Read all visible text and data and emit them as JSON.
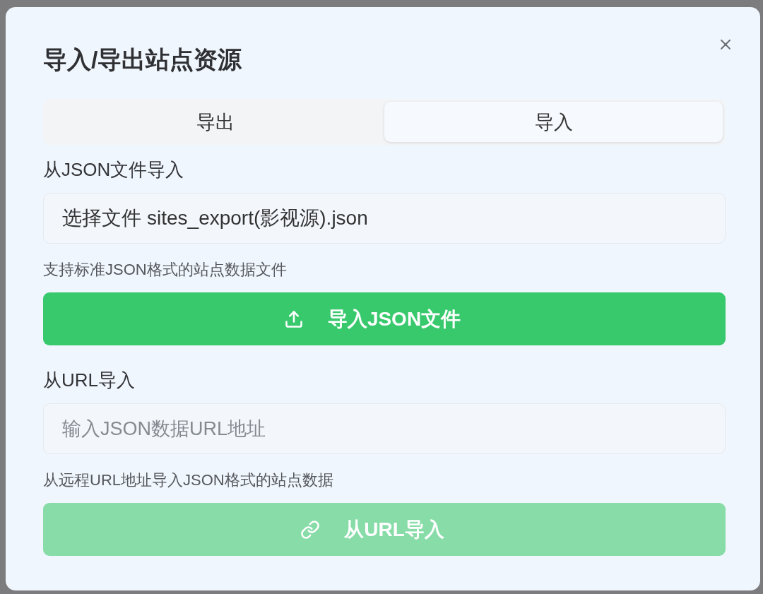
{
  "dialog": {
    "title": "导入/导出站点资源"
  },
  "tabs": [
    {
      "label": "导出",
      "selected": false
    },
    {
      "label": "导入",
      "selected": true
    }
  ],
  "sections": [
    {
      "kind": "file",
      "label": "从JSON文件导入",
      "field": {
        "button_label": "选择文件",
        "value": "sites_export(影视源).json"
      },
      "hint": "支持标准JSON格式的站点数据文件",
      "button": {
        "label": "导入JSON文件",
        "disabled": false
      }
    },
    {
      "kind": "url",
      "label": "从URL导入",
      "field": {
        "placeholder": "输入JSON数据URL地址"
      },
      "hint": "从远程URL地址导入JSON格式的站点数据",
      "button": {
        "label": "从URL导入",
        "disabled": true
      }
    }
  ]
}
